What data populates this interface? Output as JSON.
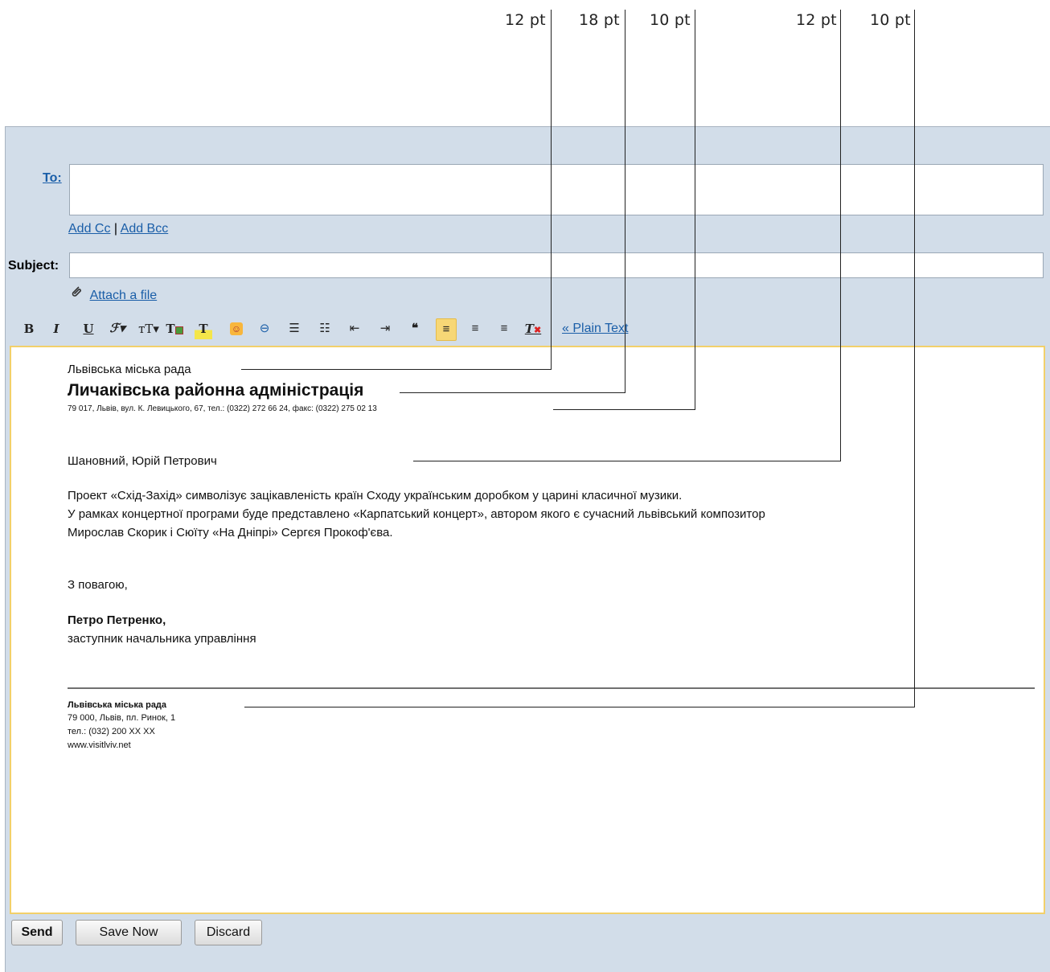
{
  "annotations": [
    {
      "label": "12 pt"
    },
    {
      "label": "18 pt"
    },
    {
      "label": "10 pt"
    },
    {
      "label": "12 pt"
    },
    {
      "label": "10 pt"
    }
  ],
  "compose": {
    "to_label": "To:",
    "add_cc": "Add Cc",
    "separator": "|",
    "add_bcc": "Add Bcc",
    "subject_label": "Subject:",
    "attach_label": "Attach a file",
    "plain_text_label": "« Plain Text"
  },
  "toolbar": {
    "items": [
      {
        "name": "bold-button",
        "glyph": "B"
      },
      {
        "name": "italic-button",
        "glyph": "I"
      },
      {
        "name": "underline-button",
        "glyph": "U"
      },
      {
        "name": "font-button",
        "glyph": "ℱ▾"
      },
      {
        "name": "font-size-button",
        "glyph": "тT▾"
      },
      {
        "name": "text-color-button",
        "glyph": "T"
      },
      {
        "name": "highlight-color-button",
        "glyph": "T"
      },
      {
        "name": "emoticon-button",
        "glyph": "☺"
      },
      {
        "name": "insert-link-button",
        "glyph": "⊖"
      },
      {
        "name": "numbered-list-button",
        "glyph": "☰"
      },
      {
        "name": "bulleted-list-button",
        "glyph": "☷"
      },
      {
        "name": "indent-less-button",
        "glyph": "⇤"
      },
      {
        "name": "indent-more-button",
        "glyph": "⇥"
      },
      {
        "name": "quote-button",
        "glyph": "❝"
      },
      {
        "name": "align-left-button",
        "glyph": "≡"
      },
      {
        "name": "align-center-button",
        "glyph": "≡"
      },
      {
        "name": "align-right-button",
        "glyph": "≡"
      },
      {
        "name": "remove-formatting-button",
        "glyph": "T"
      }
    ]
  },
  "letter": {
    "org_line": "Львівська міська рада",
    "org_title": "Личаківська районна адміністрація",
    "address_line": "79 017, Львів, вул. К. Левицького, 67,  тел.: (0322) 272 66 24,  факс: (0322) 275 02 13",
    "greeting": "Шановний, Юрій Петрович",
    "body_1": "Проект «Схід-Захід» символізує зацікавленість країн Сходу українським доробком у царині класичної музики.",
    "body_2": "У рамках концертної програми буде представлено «Карпатський концерт», автором якого є сучасний львівський композитор",
    "body_3": "Мирослав Скорик і Сюїту «На Дніпрі» Сергєя Прокоф'єва.",
    "closing": "З повагою,",
    "signer_name": "Петро Петренко,",
    "signer_title": "заступник начальника управління",
    "footer_org": "Львівська міська рада",
    "footer_address": "79 000, Львів, пл. Ринок, 1",
    "footer_phone": "тел.: (032) 200 XX XX",
    "footer_web": "www.visitlviv.net"
  },
  "buttons": {
    "send": "Send",
    "save_now": "Save Now",
    "discard": "Discard"
  },
  "colors": {
    "panel_bg": "#d2dde9",
    "link": "#1a5ea8",
    "editor_border": "#f2d06a",
    "active_tool": "#f7d776"
  }
}
